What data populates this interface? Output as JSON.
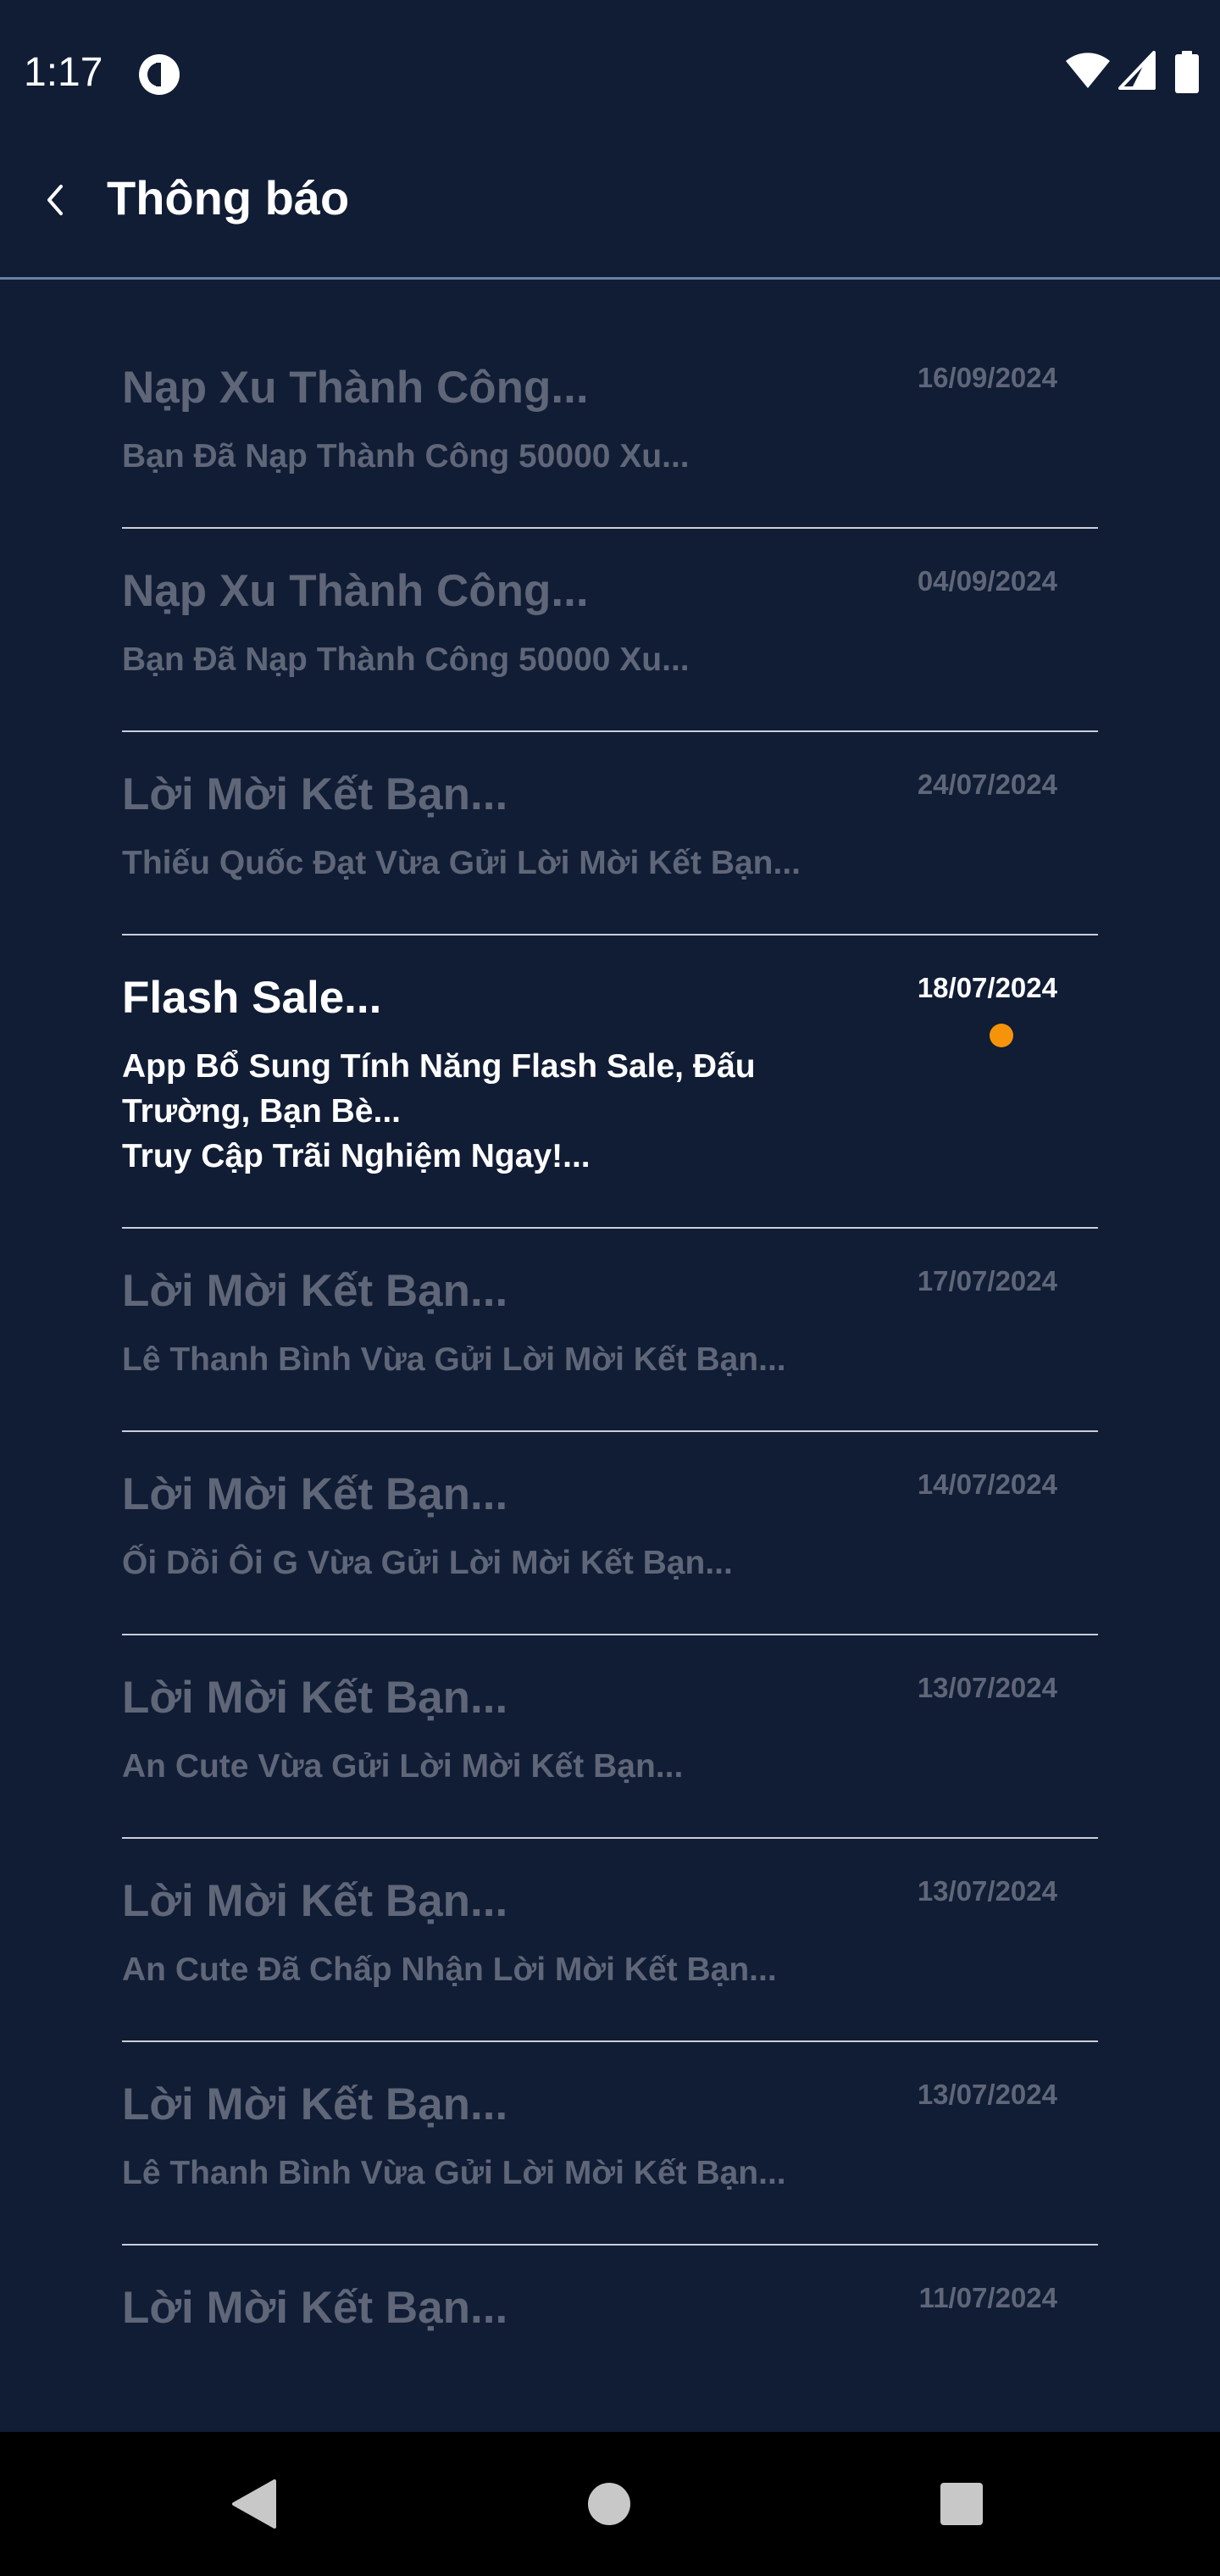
{
  "status_bar": {
    "time": "1:17"
  },
  "header": {
    "title": "Thông báo"
  },
  "colors": {
    "background": "#111c35",
    "read_text": "#5e6678",
    "unread_text": "#ffffff",
    "unread_dot": "#f5930a"
  },
  "notifications": [
    {
      "title": "Nạp Xu Thành Công...",
      "body": "Bạn Đã Nạp Thành Công 50000 Xu...",
      "date": "16/09/2024",
      "read": true
    },
    {
      "title": "Nạp Xu Thành Công...",
      "body": "Bạn Đã Nạp Thành Công 50000 Xu...",
      "date": "04/09/2024",
      "read": true
    },
    {
      "title": "Lời Mời Kết Bạn...",
      "body": "Thiếu Quốc Đạt  Vừa Gửi Lời Mời Kết Bạn...",
      "date": "24/07/2024",
      "read": true
    },
    {
      "title": "Flash Sale...",
      "body": "App Bổ Sung Tính Năng Flash Sale, Đấu Trường, Bạn Bè...\nTruy Cập Trãi Nghiệm Ngay!...",
      "date": "18/07/2024",
      "read": false
    },
    {
      "title": "Lời Mời Kết Bạn...",
      "body": "Lê Thanh Bình Vừa Gửi Lời Mời Kết Bạn...",
      "date": "17/07/2024",
      "read": true
    },
    {
      "title": "Lời Mời Kết Bạn...",
      "body": "Ối Dồi Ôi G Vừa Gửi Lời Mời Kết Bạn...",
      "date": "14/07/2024",
      "read": true
    },
    {
      "title": "Lời Mời Kết Bạn...",
      "body": "An Cute Vừa Gửi Lời Mời Kết Bạn...",
      "date": "13/07/2024",
      "read": true
    },
    {
      "title": "Lời Mời Kết Bạn...",
      "body": "An Cute Đã Chấp Nhận Lời Mời Kết Bạn...",
      "date": "13/07/2024",
      "read": true
    },
    {
      "title": "Lời Mời Kết Bạn...",
      "body": "Lê Thanh Bình Vừa Gửi Lời Mời Kết Bạn...",
      "date": "13/07/2024",
      "read": true
    },
    {
      "title": "Lời Mời Kết Bạn...",
      "body": "",
      "date": "11/07/2024",
      "read": true
    }
  ],
  "icons": {
    "status_app": "app-status-icon",
    "wifi": "wifi-icon",
    "signal": "cell-signal-icon",
    "battery": "battery-icon",
    "back": "chevron-left-icon",
    "nav_back": "nav-back-icon",
    "nav_home": "nav-home-icon",
    "nav_recents": "nav-recents-icon"
  }
}
